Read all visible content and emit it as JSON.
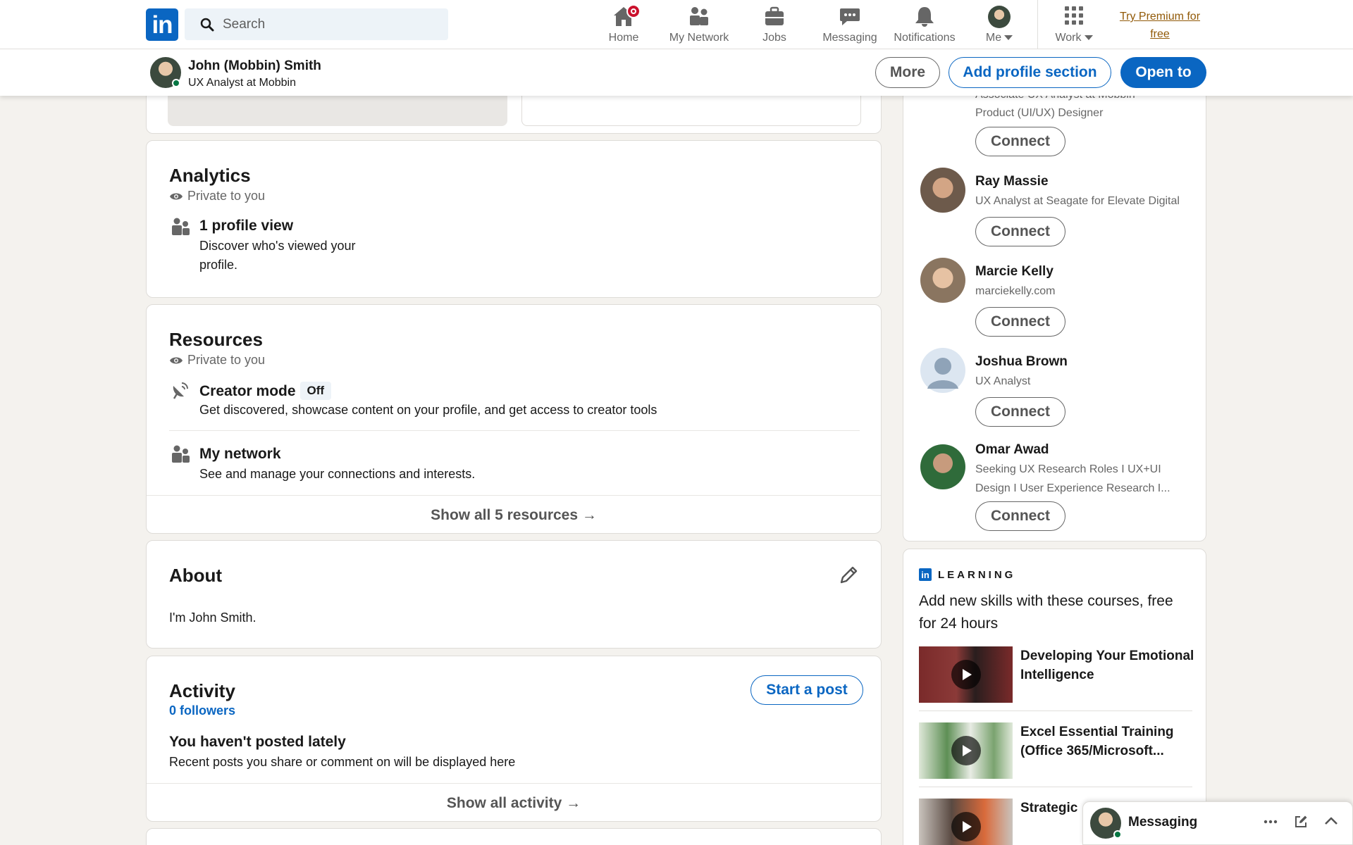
{
  "nav": {
    "search_placeholder": "Search",
    "items": [
      {
        "label": "Home"
      },
      {
        "label": "My Network"
      },
      {
        "label": "Jobs"
      },
      {
        "label": "Messaging"
      },
      {
        "label": "Notifications"
      },
      {
        "label": "Me"
      },
      {
        "label": "Work"
      }
    ],
    "premium": "Try Premium for free"
  },
  "profile_bar": {
    "name": "John (Mobbin) Smith",
    "headline": "UX Analyst at Mobbin",
    "more_label": "More",
    "add_section_label": "Add profile section",
    "open_to_label": "Open to"
  },
  "analytics": {
    "title": "Analytics",
    "private": "Private to you",
    "views_title": "1 profile view",
    "views_desc": "Discover who's viewed your profile."
  },
  "resources": {
    "title": "Resources",
    "private": "Private to you",
    "creator_title": "Creator mode",
    "creator_status": "Off",
    "creator_desc": "Get discovered, showcase content on your profile, and get access to creator tools",
    "network_title": "My network",
    "network_desc": "See and manage your connections and interests.",
    "show_all": "Show all 5 resources →"
  },
  "about": {
    "title": "About",
    "text": "I'm John Smith."
  },
  "activity": {
    "title": "Activity",
    "followers": "0 followers",
    "start_post": "Start a post",
    "empty_title": "You haven't posted lately",
    "empty_desc": "Recent posts you share or comment on will be displayed here",
    "show_all": "Show all activity →"
  },
  "people": {
    "partial_top_line": "Associate UX Analyst at Mobbin",
    "partial_sub": "Product (UI/UX) Designer",
    "connect_label": "Connect",
    "list": [
      {
        "name": "Ray Massie",
        "sub": "UX Analyst at Seagate for Elevate Digital"
      },
      {
        "name": "Marcie Kelly",
        "sub": "marciekelly.com"
      },
      {
        "name": "Joshua Brown",
        "sub": "UX Analyst"
      },
      {
        "name": "Omar Awad",
        "sub": "Seeking UX Research Roles I UX+UI Design I User Experience Research I..."
      }
    ]
  },
  "learning": {
    "logo": "in",
    "label": "LEARNING",
    "heading": "Add new skills with these courses, free for 24 hours",
    "courses": [
      {
        "title": "Developing Your Emotional Intelligence"
      },
      {
        "title": "Excel Essential Training (Office 365/Microsoft..."
      },
      {
        "title": "Strategic"
      }
    ]
  },
  "messaging": {
    "label": "Messaging"
  },
  "colors": {
    "brand": "#0a66c2",
    "premium": "#915907",
    "badge": "#cb112d",
    "online": "#057642"
  }
}
